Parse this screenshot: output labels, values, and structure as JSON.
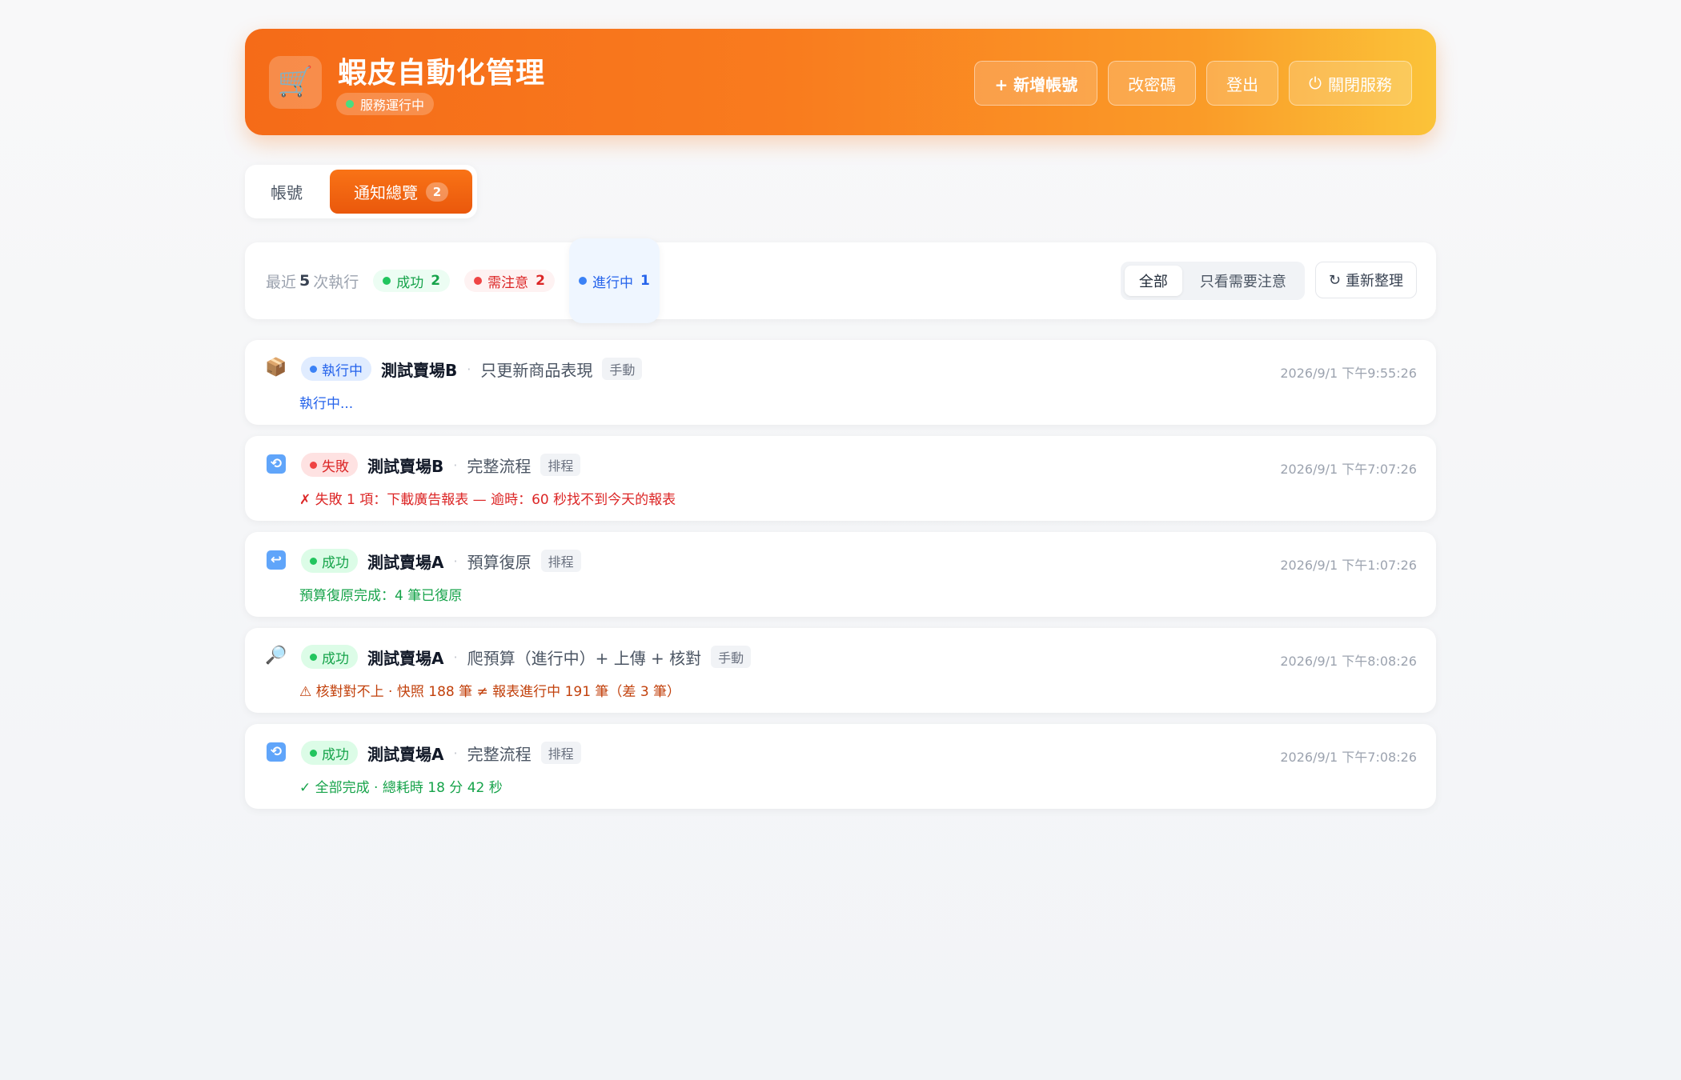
{
  "header": {
    "logo_icon": "shopping-cart-icon",
    "title": "蝦皮自動化管理",
    "status": "服務運行中",
    "buttons": {
      "add_account": "+ 新增帳號",
      "change_password": "改密碼",
      "logout": "登出",
      "shutdown": "關閉服務"
    }
  },
  "tabs": {
    "accounts": "帳號",
    "notifications": "通知總覽",
    "notifications_badge": "2"
  },
  "summary": {
    "prefix": "最近",
    "count": "5",
    "suffix": "次執行",
    "success_label": "成功",
    "success_count": "2",
    "attention_label": "需注意",
    "attention_count": "2",
    "running_label": "進行中",
    "running_count": "1",
    "filter_all": "全部",
    "filter_attention": "只看需要注意",
    "refresh": "重新整理"
  },
  "runs": [
    {
      "icon": "package-icon",
      "status": "執行中",
      "store": "測試賣場B",
      "task": "只更新商品表現",
      "trigger": "手動",
      "time": "2026/9/1 下午9:55:26",
      "message": "執行中..."
    },
    {
      "icon": "refresh-icon",
      "status": "失敗",
      "store": "測試賣場B",
      "task": "完整流程",
      "trigger": "排程",
      "time": "2026/9/1 下午7:07:26",
      "message": "✗ 失敗 1 項：下載廣告報表 — 逾時：60 秒找不到今天的報表"
    },
    {
      "icon": "return-arrow-icon",
      "status": "成功",
      "store": "測試賣場A",
      "task": "預算復原",
      "trigger": "排程",
      "time": "2026/9/1 下午1:07:26",
      "message": "預算復原完成：4 筆已復原"
    },
    {
      "icon": "magnifier-icon",
      "status": "成功",
      "store": "測試賣場A",
      "task": "爬預算（進行中）+ 上傳 + 核對",
      "trigger": "手動",
      "time": "2026/9/1 下午8:08:26",
      "message": "⚠ 核對對不上 · 快照 188 筆 ≠ 報表進行中 191 筆（差 3 筆）"
    },
    {
      "icon": "refresh-icon",
      "status": "成功",
      "store": "測試賣場A",
      "task": "完整流程",
      "trigger": "排程",
      "time": "2026/9/1 下午7:08:26",
      "message": "✓ 全部完成 · 總耗時 18 分 42 秒"
    }
  ]
}
